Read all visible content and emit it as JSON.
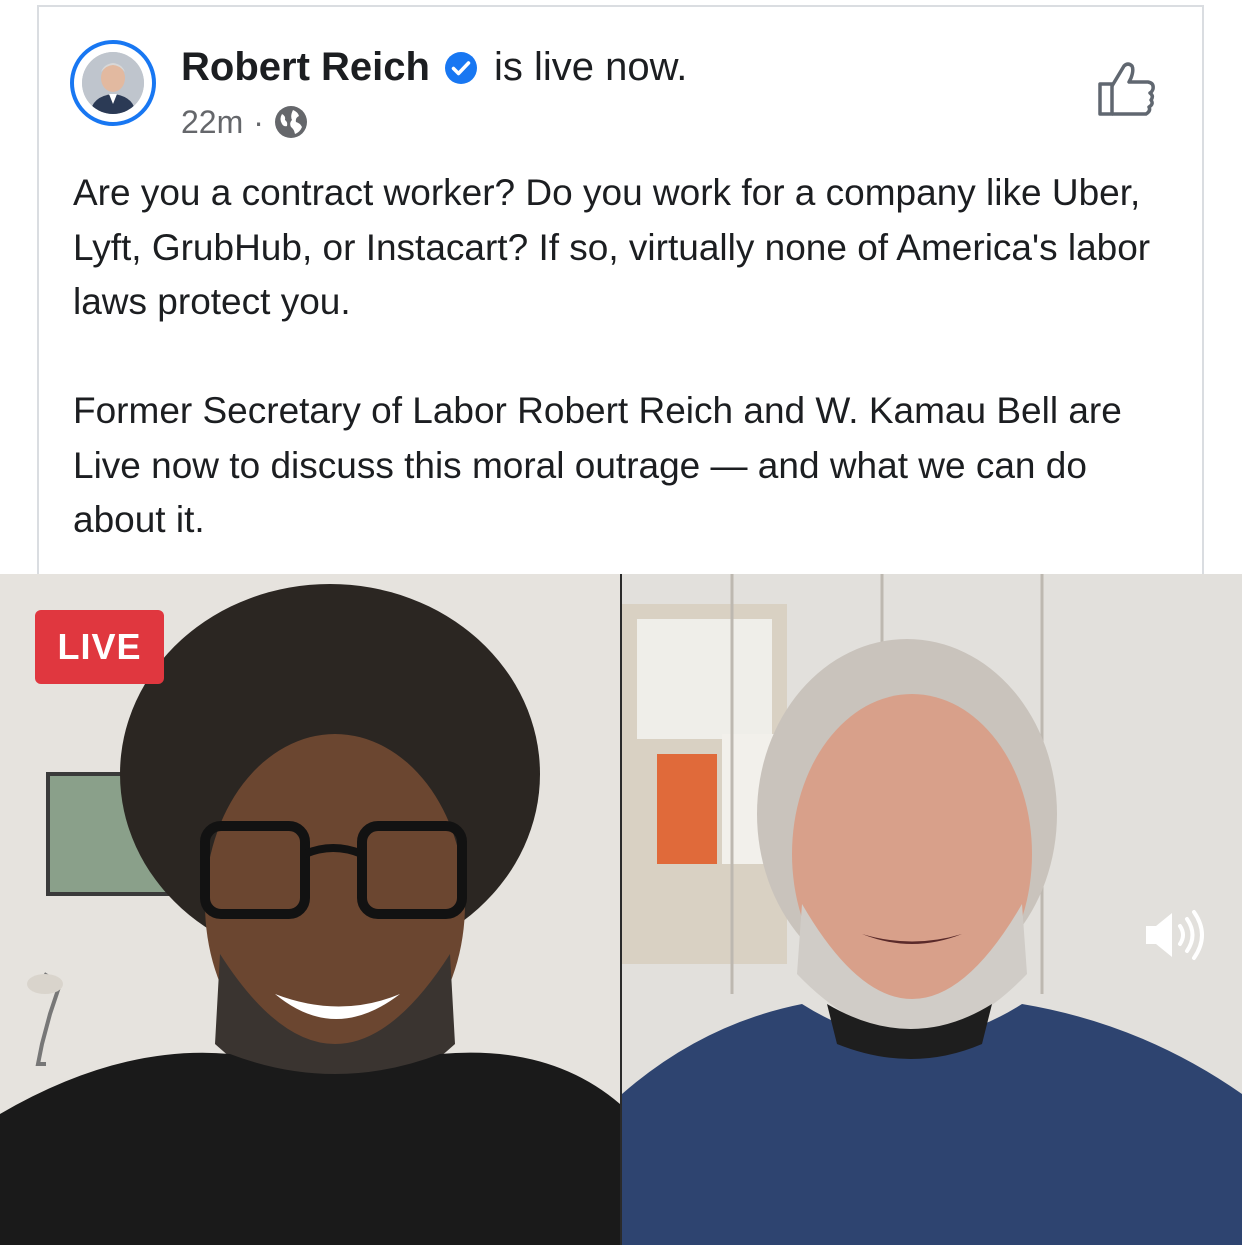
{
  "post": {
    "author": "Robert Reich",
    "status": "is live now.",
    "time": "22m",
    "separator": "·",
    "privacy_icon": "globe-icon",
    "verified_icon": "verified-badge-icon",
    "like_icon": "thumbs-up-icon",
    "paragraphs": [
      "Are you a contract worker? Do you work for a company like Uber, Lyft, GrubHub, or Instacart? If so, virtually none of America's labor laws protect you.",
      "Former Secretary of Labor Robert Reich and W. Kamau Bell are Live now to discuss this moral outrage — and what we can do about it."
    ]
  },
  "video": {
    "live_label": "LIVE",
    "volume_icon": "speaker-volume-icon"
  },
  "colors": {
    "accent": "#1877f2",
    "live_red": "#e0373f",
    "meta_gray": "#65676b"
  }
}
